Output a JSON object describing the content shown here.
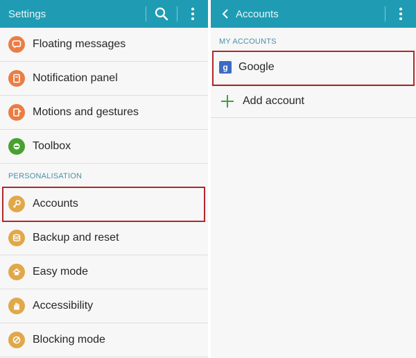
{
  "left": {
    "title": "Settings",
    "items_top": [
      {
        "label": "Floating messages",
        "icon": "chat-bubble-icon"
      },
      {
        "label": "Notification panel",
        "icon": "notification-panel-icon"
      },
      {
        "label": "Motions and gestures",
        "icon": "hand-motion-icon"
      },
      {
        "label": "Toolbox",
        "icon": "toolbox-icon"
      }
    ],
    "section": "PERSONALISATION",
    "items_personal": [
      {
        "label": "Accounts",
        "icon": "key-icon"
      },
      {
        "label": "Backup and reset",
        "icon": "backup-icon"
      },
      {
        "label": "Easy mode",
        "icon": "home-icon"
      },
      {
        "label": "Accessibility",
        "icon": "hand-icon"
      },
      {
        "label": "Blocking mode",
        "icon": "block-icon"
      }
    ]
  },
  "right": {
    "title": "Accounts",
    "section": "MY ACCOUNTS",
    "google_label": "Google",
    "add_label": "Add account"
  },
  "colors": {
    "appbar": "#1f9cb3",
    "highlight": "#b1262a",
    "section_text": "#4a90a6"
  }
}
